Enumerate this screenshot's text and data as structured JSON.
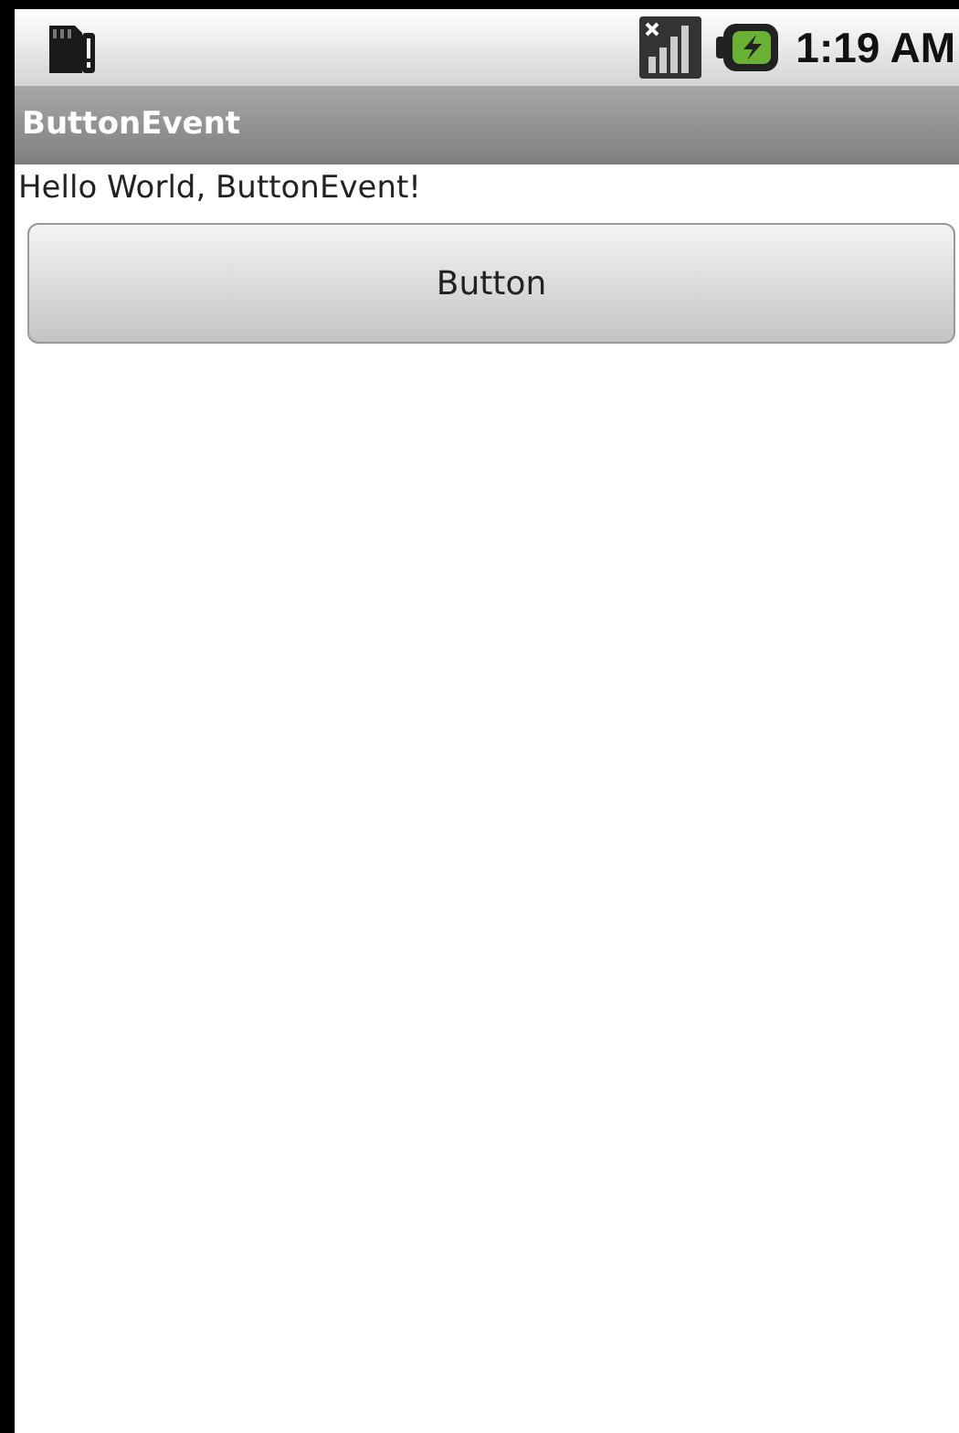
{
  "status_bar": {
    "time": "1:19 AM"
  },
  "title_bar": {
    "title": "ButtonEvent"
  },
  "content": {
    "text": "Hello World, ButtonEvent!",
    "button": {
      "label": "Button"
    }
  }
}
